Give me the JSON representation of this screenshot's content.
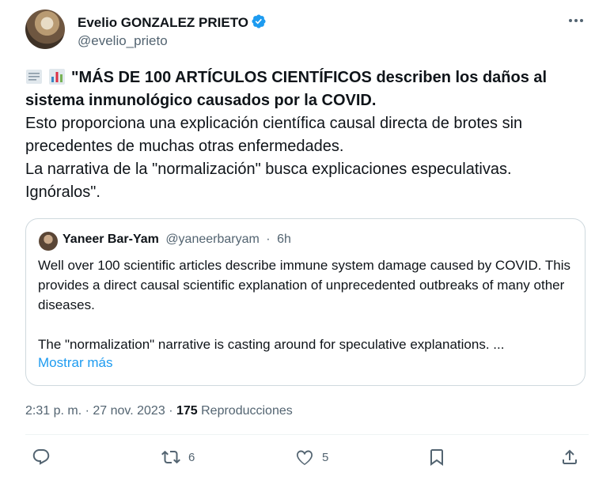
{
  "author": {
    "name": "Evelio GONZALEZ PRIETO",
    "handle": "@evelio_prieto"
  },
  "tweet": {
    "emoji_1": "document-emoji",
    "emoji_2": "bar-chart-emoji",
    "bold_text": "\"MÁS DE 100 ARTÍCULOS CIENTÍFICOS describen los daños al sistema inmunológico causados por la COVID.",
    "line_2": "Esto proporciona una explicación científica causal directa de brotes sin precedentes de muchas otras enfermedades.",
    "line_3": "La narrativa de la \"normalización\" busca explicaciones especulativas.",
    "line_4": "Ignóralos\"."
  },
  "quote": {
    "name": "Yaneer Bar-Yam",
    "handle": "@yaneerbaryam",
    "separator": "·",
    "time": "6h",
    "paragraph_1": "Well over 100 scientific articles describe immune system damage caused by COVID. This provides a direct causal scientific explanation of unprecedented outbreaks of many other diseases.",
    "paragraph_2": "The \"normalization\" narrative is casting around for speculative explanations. ...",
    "show_more": "Mostrar más"
  },
  "meta": {
    "time": "2:31 p. m.",
    "separator": "·",
    "date": "27 nov. 2023",
    "views_count": "175",
    "views_label": "Reproducciones"
  },
  "actions": {
    "reply_count": "",
    "retweet_count": "6",
    "like_count": "5"
  },
  "colors": {
    "verified": "#1d9bf0",
    "link": "#1d9bf0",
    "muted": "#536471",
    "text": "#0f1419",
    "border": "#cfd9de"
  }
}
